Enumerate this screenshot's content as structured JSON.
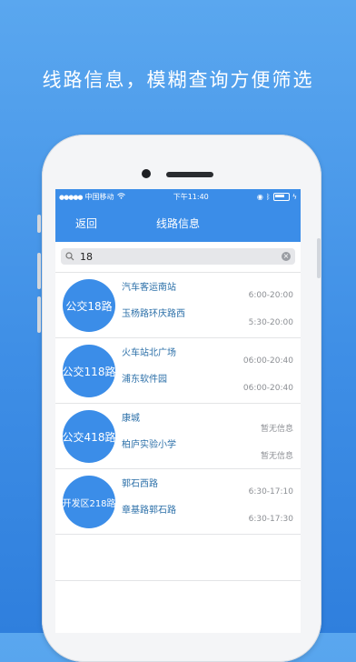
{
  "headline": "线路信息，模糊查询方便筛选",
  "status": {
    "carrier": "中国移动",
    "time": "下午11:40"
  },
  "nav": {
    "back": "返回",
    "title": "线路信息"
  },
  "search": {
    "value": "18"
  },
  "routes": [
    {
      "name": "公交18路",
      "from": "汽车客运南站",
      "from_time": "6:00-20:00",
      "to": "玉杨路环庆路西",
      "to_time": "5:30-20:00"
    },
    {
      "name": "公交118路",
      "from": "火车站北广场",
      "from_time": "06:00-20:40",
      "to": "浦东软件园",
      "to_time": "06:00-20:40"
    },
    {
      "name": "公交418路",
      "from": "康城",
      "from_time": "暂无信息",
      "to": "柏庐实验小学",
      "to_time": "暂无信息"
    },
    {
      "name": "开发区218路",
      "from": "郭石西路",
      "from_time": "6:30-17:10",
      "to": "章基路郭石路",
      "to_time": "6:30-17:30"
    }
  ],
  "colors": {
    "accent": "#3b8de8",
    "background": "#4a9aea"
  }
}
